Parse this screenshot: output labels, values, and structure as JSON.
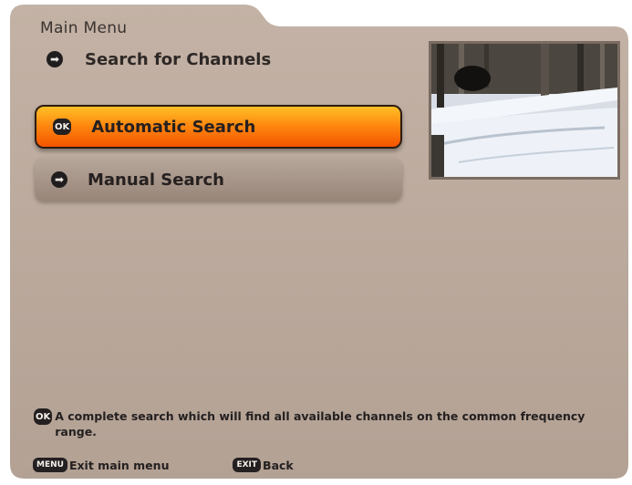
{
  "menu": {
    "breadcrumb": "Main Menu",
    "section_title": "Search for Channels",
    "items": [
      {
        "label": "Automatic Search",
        "key": "OK",
        "selected": true
      },
      {
        "label": "Manual Search",
        "key": "arrow",
        "selected": false
      }
    ]
  },
  "help": {
    "key": "OK",
    "text": "A complete search which will find all available channels on the common frequency range."
  },
  "footer": {
    "buttons": [
      {
        "key": "MENU",
        "label": "Exit main menu"
      },
      {
        "key": "EXIT",
        "label": "Back"
      }
    ]
  },
  "colors": {
    "panel": "#bba99c",
    "selected_gradient_top": "#ffc028",
    "selected_gradient_bottom": "#f45400",
    "item_background": "#a59385",
    "text": "#262020"
  }
}
